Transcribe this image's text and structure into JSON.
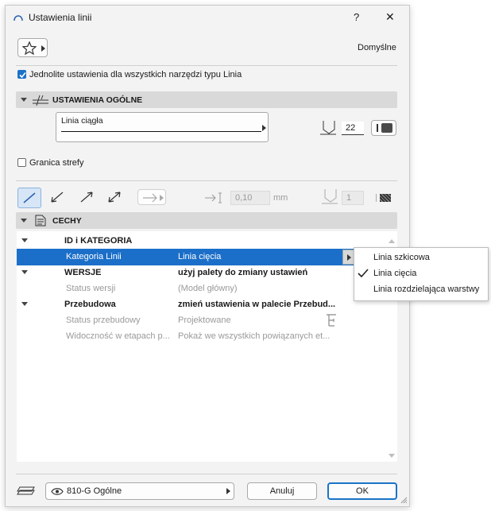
{
  "window": {
    "title": "Ustawienia linii",
    "help": "?",
    "close": "✕"
  },
  "favorites": {
    "preset_name": "Domyślne"
  },
  "uniform_checkbox": {
    "label": "Jednolite ustawienia dla wszystkich narzędzi typu Linia",
    "checked": true
  },
  "general": {
    "title": "USTAWIENIA OGÓLNE",
    "line_type": "Linia ciągła",
    "pen_number": "22",
    "zone_boundary_label": "Granica strefy",
    "arrow_size": "0,10",
    "arrow_unit": "mm",
    "arrow_pen": "1"
  },
  "features": {
    "title": "CECHY",
    "rows": [
      {
        "col1": "ID i KATEGORIA",
        "col2": "",
        "type": "group"
      },
      {
        "col1": "Kategoria Linii",
        "col2": "Linia cięcia",
        "type": "selected"
      },
      {
        "col1": "WERSJE",
        "col2": "użyj palety do zmiany ustawień",
        "type": "group"
      },
      {
        "col1": "Status wersji",
        "col2": "(Model główny)",
        "type": "grey"
      },
      {
        "col1": "Przebudowa",
        "col2": "zmień ustawienia w palecie Przebud...",
        "type": "group"
      },
      {
        "col1": "Status przebudowy",
        "col2": "Projektowane",
        "type": "grey"
      },
      {
        "col1": "Widoczność w etapach p...",
        "col2": "Pokaż we wszystkich powiązanych et...",
        "type": "grey"
      }
    ]
  },
  "dropdown_menu": {
    "items": [
      "Linia szkicowa",
      "Linia cięcia",
      "Linia rozdzielająca warstwy"
    ],
    "checked_index": 1
  },
  "footer": {
    "layer": "810-G Ogólne",
    "cancel": "Anuluj",
    "ok": "OK"
  },
  "colors": {
    "selection": "#1b6fc9",
    "accent": "#1a73c9",
    "section_bar": "#d9d9d9"
  }
}
